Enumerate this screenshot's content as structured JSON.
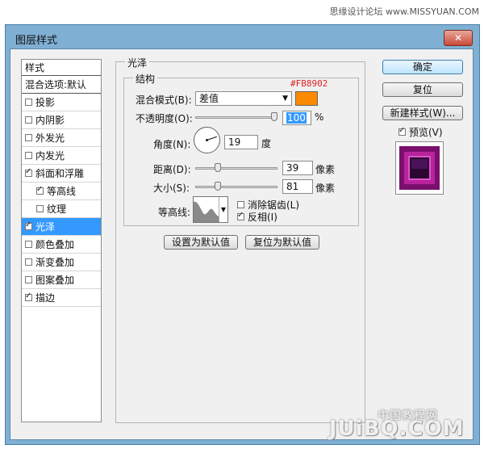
{
  "watermark_top": "思缘设计论坛 www.MISSYUAN.COM",
  "window": {
    "title": "图层样式",
    "close_label": "✕"
  },
  "left_list": {
    "header": "样式",
    "blend_options": "混合选项:默认",
    "items": [
      {
        "label": "投影",
        "checked": false,
        "sub": false,
        "selected": false
      },
      {
        "label": "内阴影",
        "checked": false,
        "sub": false,
        "selected": false
      },
      {
        "label": "外发光",
        "checked": false,
        "sub": false,
        "selected": false
      },
      {
        "label": "内发光",
        "checked": false,
        "sub": false,
        "selected": false
      },
      {
        "label": "斜面和浮雕",
        "checked": true,
        "sub": false,
        "selected": false
      },
      {
        "label": "等高线",
        "checked": true,
        "sub": true,
        "selected": false
      },
      {
        "label": "纹理",
        "checked": false,
        "sub": true,
        "selected": false
      },
      {
        "label": "光泽",
        "checked": true,
        "sub": false,
        "selected": true
      },
      {
        "label": "颜色叠加",
        "checked": false,
        "sub": false,
        "selected": false
      },
      {
        "label": "渐变叠加",
        "checked": false,
        "sub": false,
        "selected": false
      },
      {
        "label": "图案叠加",
        "checked": false,
        "sub": false,
        "selected": false
      },
      {
        "label": "描边",
        "checked": true,
        "sub": false,
        "selected": false
      }
    ]
  },
  "panel": {
    "section_title": "光泽",
    "group_title": "结构",
    "color_note": "#FB8902",
    "blend_mode": {
      "label": "混合模式(B):",
      "value": "差值",
      "color": "#FB8902"
    },
    "opacity": {
      "label": "不透明度(O):",
      "value": "100",
      "unit": "%",
      "fraction": 1.0
    },
    "angle": {
      "label": "角度(N):",
      "value": "19",
      "unit": "度",
      "degrees": 19
    },
    "distance": {
      "label": "距离(D):",
      "value": "39",
      "unit": "像素",
      "fraction": 0.26
    },
    "size": {
      "label": "大小(S):",
      "value": "81",
      "unit": "像素",
      "fraction": 0.26
    },
    "contour": {
      "label": "等高线:",
      "anti_alias": "消除锯齿(L)",
      "anti_alias_checked": false,
      "invert": "反相(I)",
      "invert_checked": true
    },
    "make_default": "设置为默认值",
    "reset_default": "复位为默认值"
  },
  "right": {
    "ok": "确定",
    "reset": "复位",
    "new_style": "新建样式(W)...",
    "preview": "预览(V)",
    "preview_checked": true,
    "preview_color": "#7a0f6e"
  },
  "site_watermark": {
    "text": "JUiBQ.COM",
    "cn": "中国教程网"
  }
}
